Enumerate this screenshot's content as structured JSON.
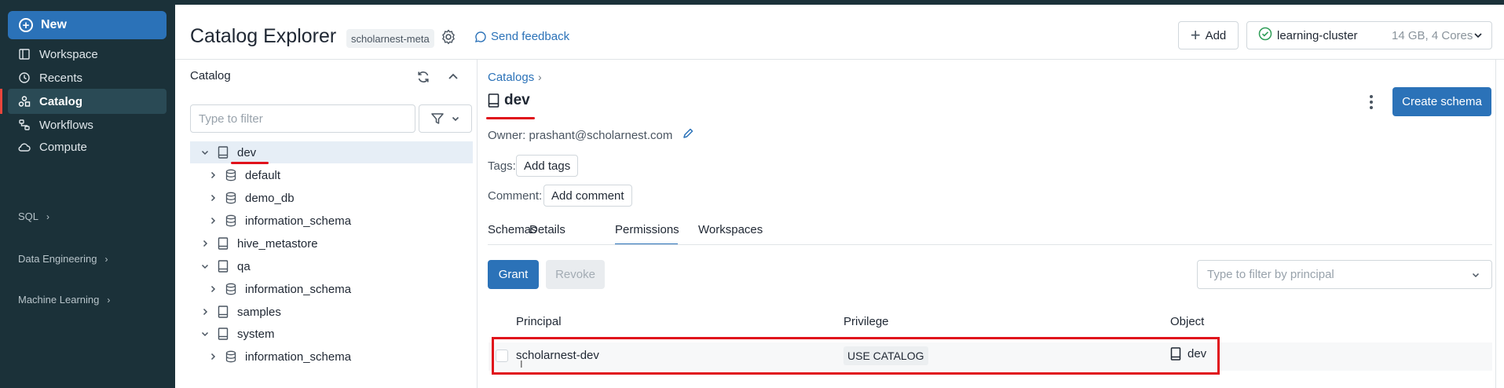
{
  "sidebar": {
    "new_label": "New",
    "items": [
      {
        "label": "Workspace",
        "icon": "workspace-icon"
      },
      {
        "label": "Recents",
        "icon": "clock-icon"
      },
      {
        "label": "Catalog",
        "icon": "catalog-icon",
        "active": true
      },
      {
        "label": "Workflows",
        "icon": "workflows-icon"
      },
      {
        "label": "Compute",
        "icon": "cloud-icon"
      }
    ],
    "groups": [
      {
        "label": "SQL"
      },
      {
        "label": "Data Engineering"
      },
      {
        "label": "Machine Learning"
      }
    ]
  },
  "header": {
    "title": "Catalog Explorer",
    "metastore_badge": "scholarnest-meta",
    "feedback_label": "Send feedback",
    "add_label": "Add",
    "cluster_name": "learning-cluster",
    "cluster_spec": "14 GB, 4 Cores"
  },
  "catalog_panel": {
    "title": "Catalog",
    "filter_placeholder": "Type to filter",
    "tree": [
      {
        "label": "dev",
        "level": 0,
        "expanded": true,
        "type": "catalog",
        "selected": true
      },
      {
        "label": "default",
        "level": 1,
        "expanded": false,
        "type": "schema"
      },
      {
        "label": "demo_db",
        "level": 1,
        "expanded": false,
        "type": "schema"
      },
      {
        "label": "information_schema",
        "level": 1,
        "expanded": false,
        "type": "schema"
      },
      {
        "label": "hive_metastore",
        "level": 0,
        "expanded": false,
        "type": "catalog"
      },
      {
        "label": "qa",
        "level": 0,
        "expanded": true,
        "type": "catalog"
      },
      {
        "label": "information_schema",
        "level": 1,
        "expanded": false,
        "type": "schema"
      },
      {
        "label": "samples",
        "level": 0,
        "expanded": false,
        "type": "catalog"
      },
      {
        "label": "system",
        "level": 0,
        "expanded": true,
        "type": "catalog"
      },
      {
        "label": "information_schema",
        "level": 1,
        "expanded": false,
        "type": "schema"
      }
    ]
  },
  "detail": {
    "breadcrumb": "Catalogs",
    "breadcrumb_sep": "›",
    "name": "dev",
    "create_schema_label": "Create schema",
    "owner_text": "Owner: prashant@scholarnest.com",
    "tags_label": "Tags:",
    "add_tags_label": "Add tags",
    "comment_label": "Comment:",
    "add_comment_label": "Add comment",
    "tabs": [
      "Schemas",
      "Details",
      "Permissions",
      "Workspaces"
    ],
    "active_tab": "Permissions",
    "grant_label": "Grant",
    "revoke_label": "Revoke",
    "principal_filter_placeholder": "Type to filter by principal",
    "table": {
      "headers": [
        "Principal",
        "Privilege",
        "Object"
      ],
      "rows": [
        {
          "principal": "scholarnest-dev",
          "privilege": "USE CATALOG",
          "object": "dev"
        }
      ]
    }
  },
  "colors": {
    "sidebar_bg": "#1b3139",
    "primary": "#2b72b8",
    "annotation_red": "#e0121b"
  }
}
